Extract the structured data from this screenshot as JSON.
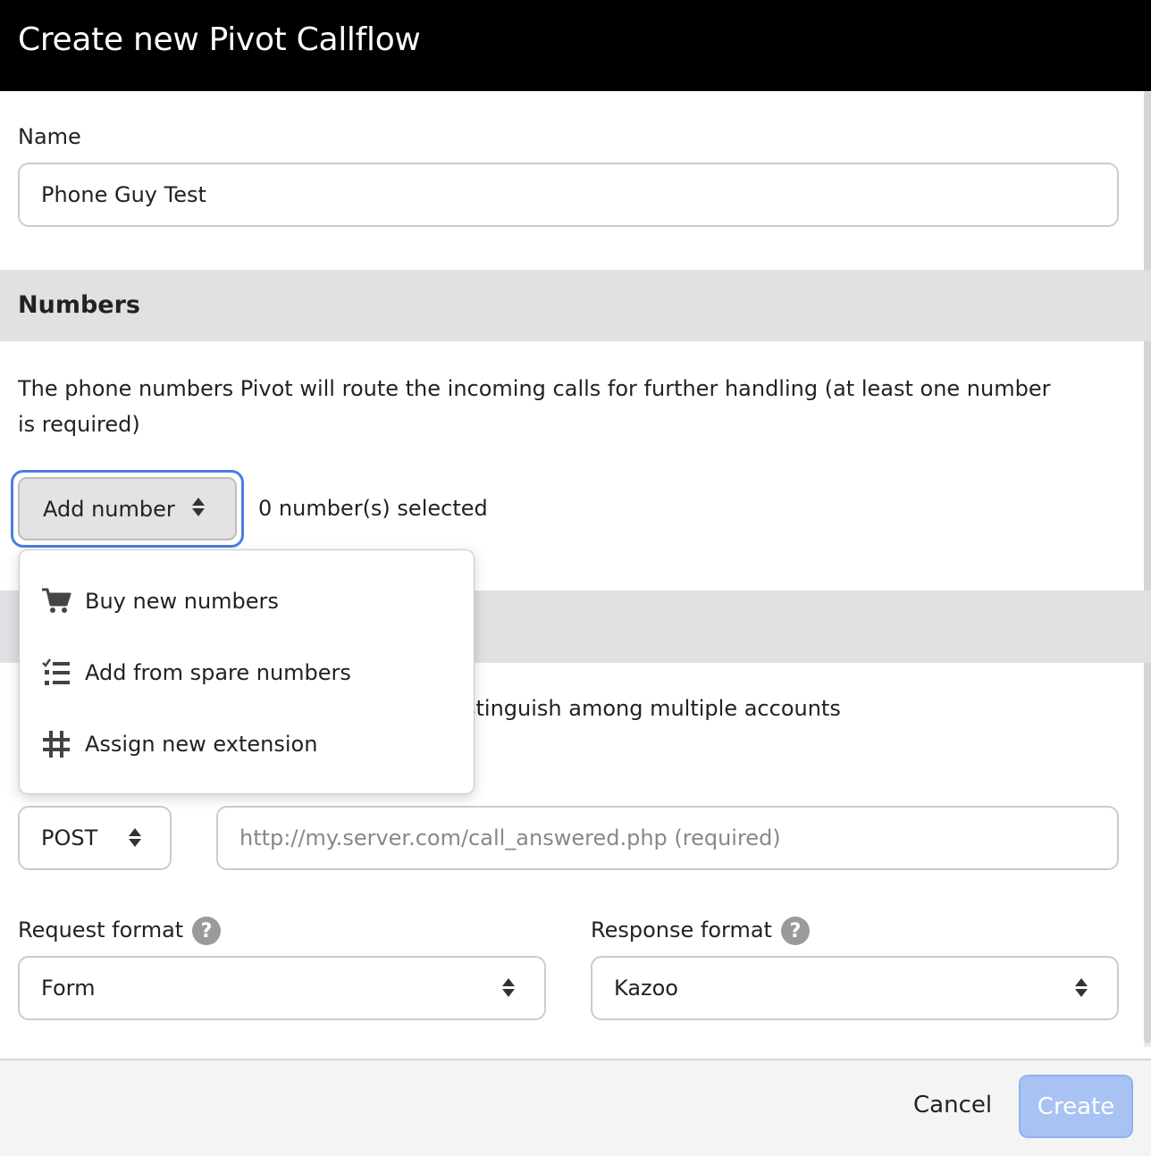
{
  "modal": {
    "title": "Create new Pivot Callflow"
  },
  "name_field": {
    "label": "Name",
    "value": "Phone Guy Test"
  },
  "numbers_section": {
    "title": "Numbers",
    "description": "The phone numbers Pivot will route the incoming calls for further handling (at least one number is required)",
    "add_button_label": "Add number",
    "selected_count": "0 number(s) selected"
  },
  "add_number_menu": {
    "items": [
      {
        "label": "Buy new numbers",
        "icon": "cart-icon"
      },
      {
        "label": "Add from spare numbers",
        "icon": "checklist-icon"
      },
      {
        "label": "Assign new extension",
        "icon": "hash-icon"
      }
    ]
  },
  "partially_hidden": {
    "text": "stinguish among multiple accounts"
  },
  "request": {
    "method": "POST",
    "url_placeholder": "http://my.server.com/call_answered.php (required)",
    "request_format_label": "Request format",
    "request_format_value": "Form",
    "response_format_label": "Response format",
    "response_format_value": "Kazoo",
    "help_glyph": "?"
  },
  "footer": {
    "cancel_label": "Cancel",
    "create_label": "Create"
  },
  "colors": {
    "header_bg": "#000000",
    "primary_disabled": "#a8c2f3",
    "focus_ring": "#4a7fe0",
    "section_bg": "#e1e1e4"
  }
}
